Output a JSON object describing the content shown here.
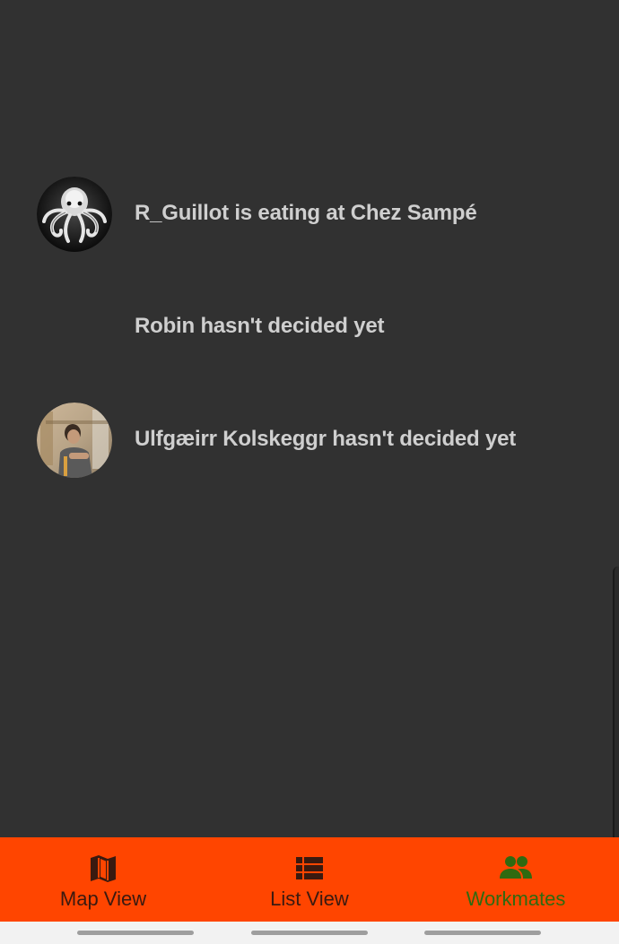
{
  "workmates": [
    {
      "avatar_icon": "octopus-avatar",
      "text": "R_Guillot is eating at Chez Sampé"
    },
    {
      "avatar_icon": "none",
      "text": "Robin hasn't decided yet"
    },
    {
      "avatar_icon": "person-photo-avatar",
      "text": "Ulfgæirr Kolskeggr hasn't decided yet"
    }
  ],
  "bottom_nav": {
    "items": [
      {
        "label": "Map View",
        "icon": "map-icon",
        "active": false
      },
      {
        "label": "List View",
        "icon": "list-icon",
        "active": false
      },
      {
        "label": "Workmates",
        "icon": "people-icon",
        "active": true
      }
    ]
  },
  "colors": {
    "background": "#313131",
    "nav_background": "#ff4500",
    "nav_active": "#2f6a10",
    "nav_inactive": "#3a1a10",
    "text": "#cfcfcf"
  }
}
